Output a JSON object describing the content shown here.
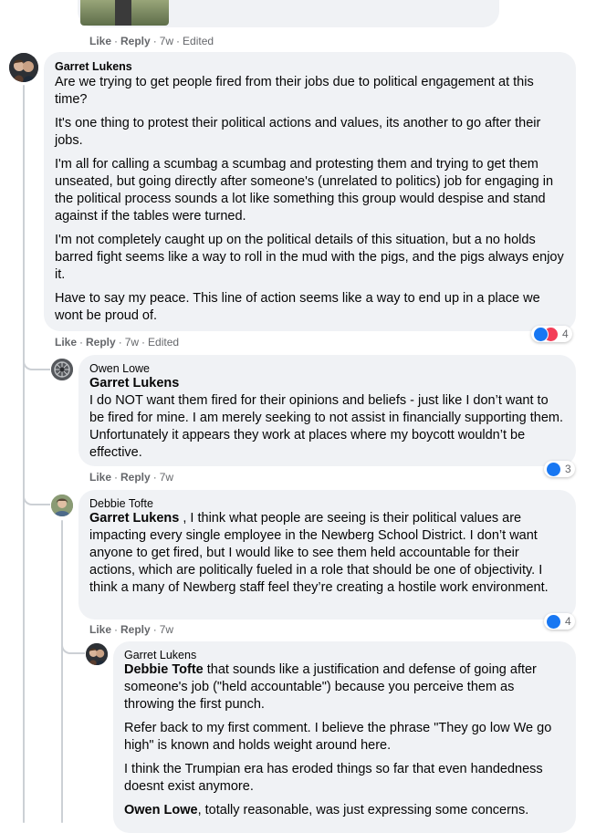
{
  "top": {
    "actions": {
      "like": "Like",
      "reply": "Reply",
      "time": "7w",
      "edited": "Edited"
    }
  },
  "c1": {
    "author": "Garret Lukens",
    "paragraphs": [
      "Are we trying to get people fired from their jobs due to political engagement at this time?",
      "It's one thing to protest their political actions and values, its another to go after their jobs.",
      "I'm all for calling a scumbag a scumbag and protesting them and trying to get them unseated, but going directly after someone's (unrelated to politics) job for engaging in the political process sounds a lot like something this group would despise and stand against if the tables were turned.",
      "I'm not completely caught up on the political details of this situation, but a no holds barred fight seems like a way to roll in the mud with the pigs, and the pigs always enjoy it.",
      "Have to say my peace. This line of action seems like a way to end up in a place we wont be proud of."
    ],
    "reactions_count": "4",
    "actions": {
      "like": "Like",
      "reply": "Reply",
      "time": "7w",
      "edited": "Edited"
    }
  },
  "c2": {
    "author": "Owen Lowe",
    "mention": "Garret Lukens",
    "text": "I do NOT want them fired for their opinions and beliefs - just like I don’t want to be fired for mine. I am merely seeking to not assist in financially supporting them. Unfortunately it appears they work at places where my boycott wouldn’t be effective.",
    "reactions_count": "3",
    "actions": {
      "like": "Like",
      "reply": "Reply",
      "time": "7w"
    }
  },
  "c3": {
    "author": "Debbie Tofte",
    "mention": "Garret Lukens",
    "text": " , I think what people are seeing is their political values are impacting every single employee in the Newberg School District. I don’t want anyone to get fired, but I would like to see them held accountable for their actions, which are politically fueled in a role that should be one of objectivity. I think a many of Newberg staff feel they’re creating a hostile work environment.",
    "reactions_count": "4",
    "actions": {
      "like": "Like",
      "reply": "Reply",
      "time": "7w"
    }
  },
  "c4": {
    "author": "Garret Lukens",
    "mention1": "Debbie Tofte",
    "p1": " that sounds like a justification and defense of going after someone's job (\"held accountable\") because you perceive them as throwing the first punch.",
    "p2": "Refer back to my first comment. I believe the phrase \"They go low We go high\" is known and holds weight around here.",
    "p3": "I think the Trumpian era has eroded things so far that even handedness doesnt exist anymore.",
    "mention2": "Owen Lowe",
    "p4": ", totally reasonable, was just expressing some concerns."
  },
  "colors": {
    "bubble": "#f0f2f5",
    "meta": "#65676b",
    "like_blue": "#1877f2",
    "love_red": "#f33e58"
  }
}
